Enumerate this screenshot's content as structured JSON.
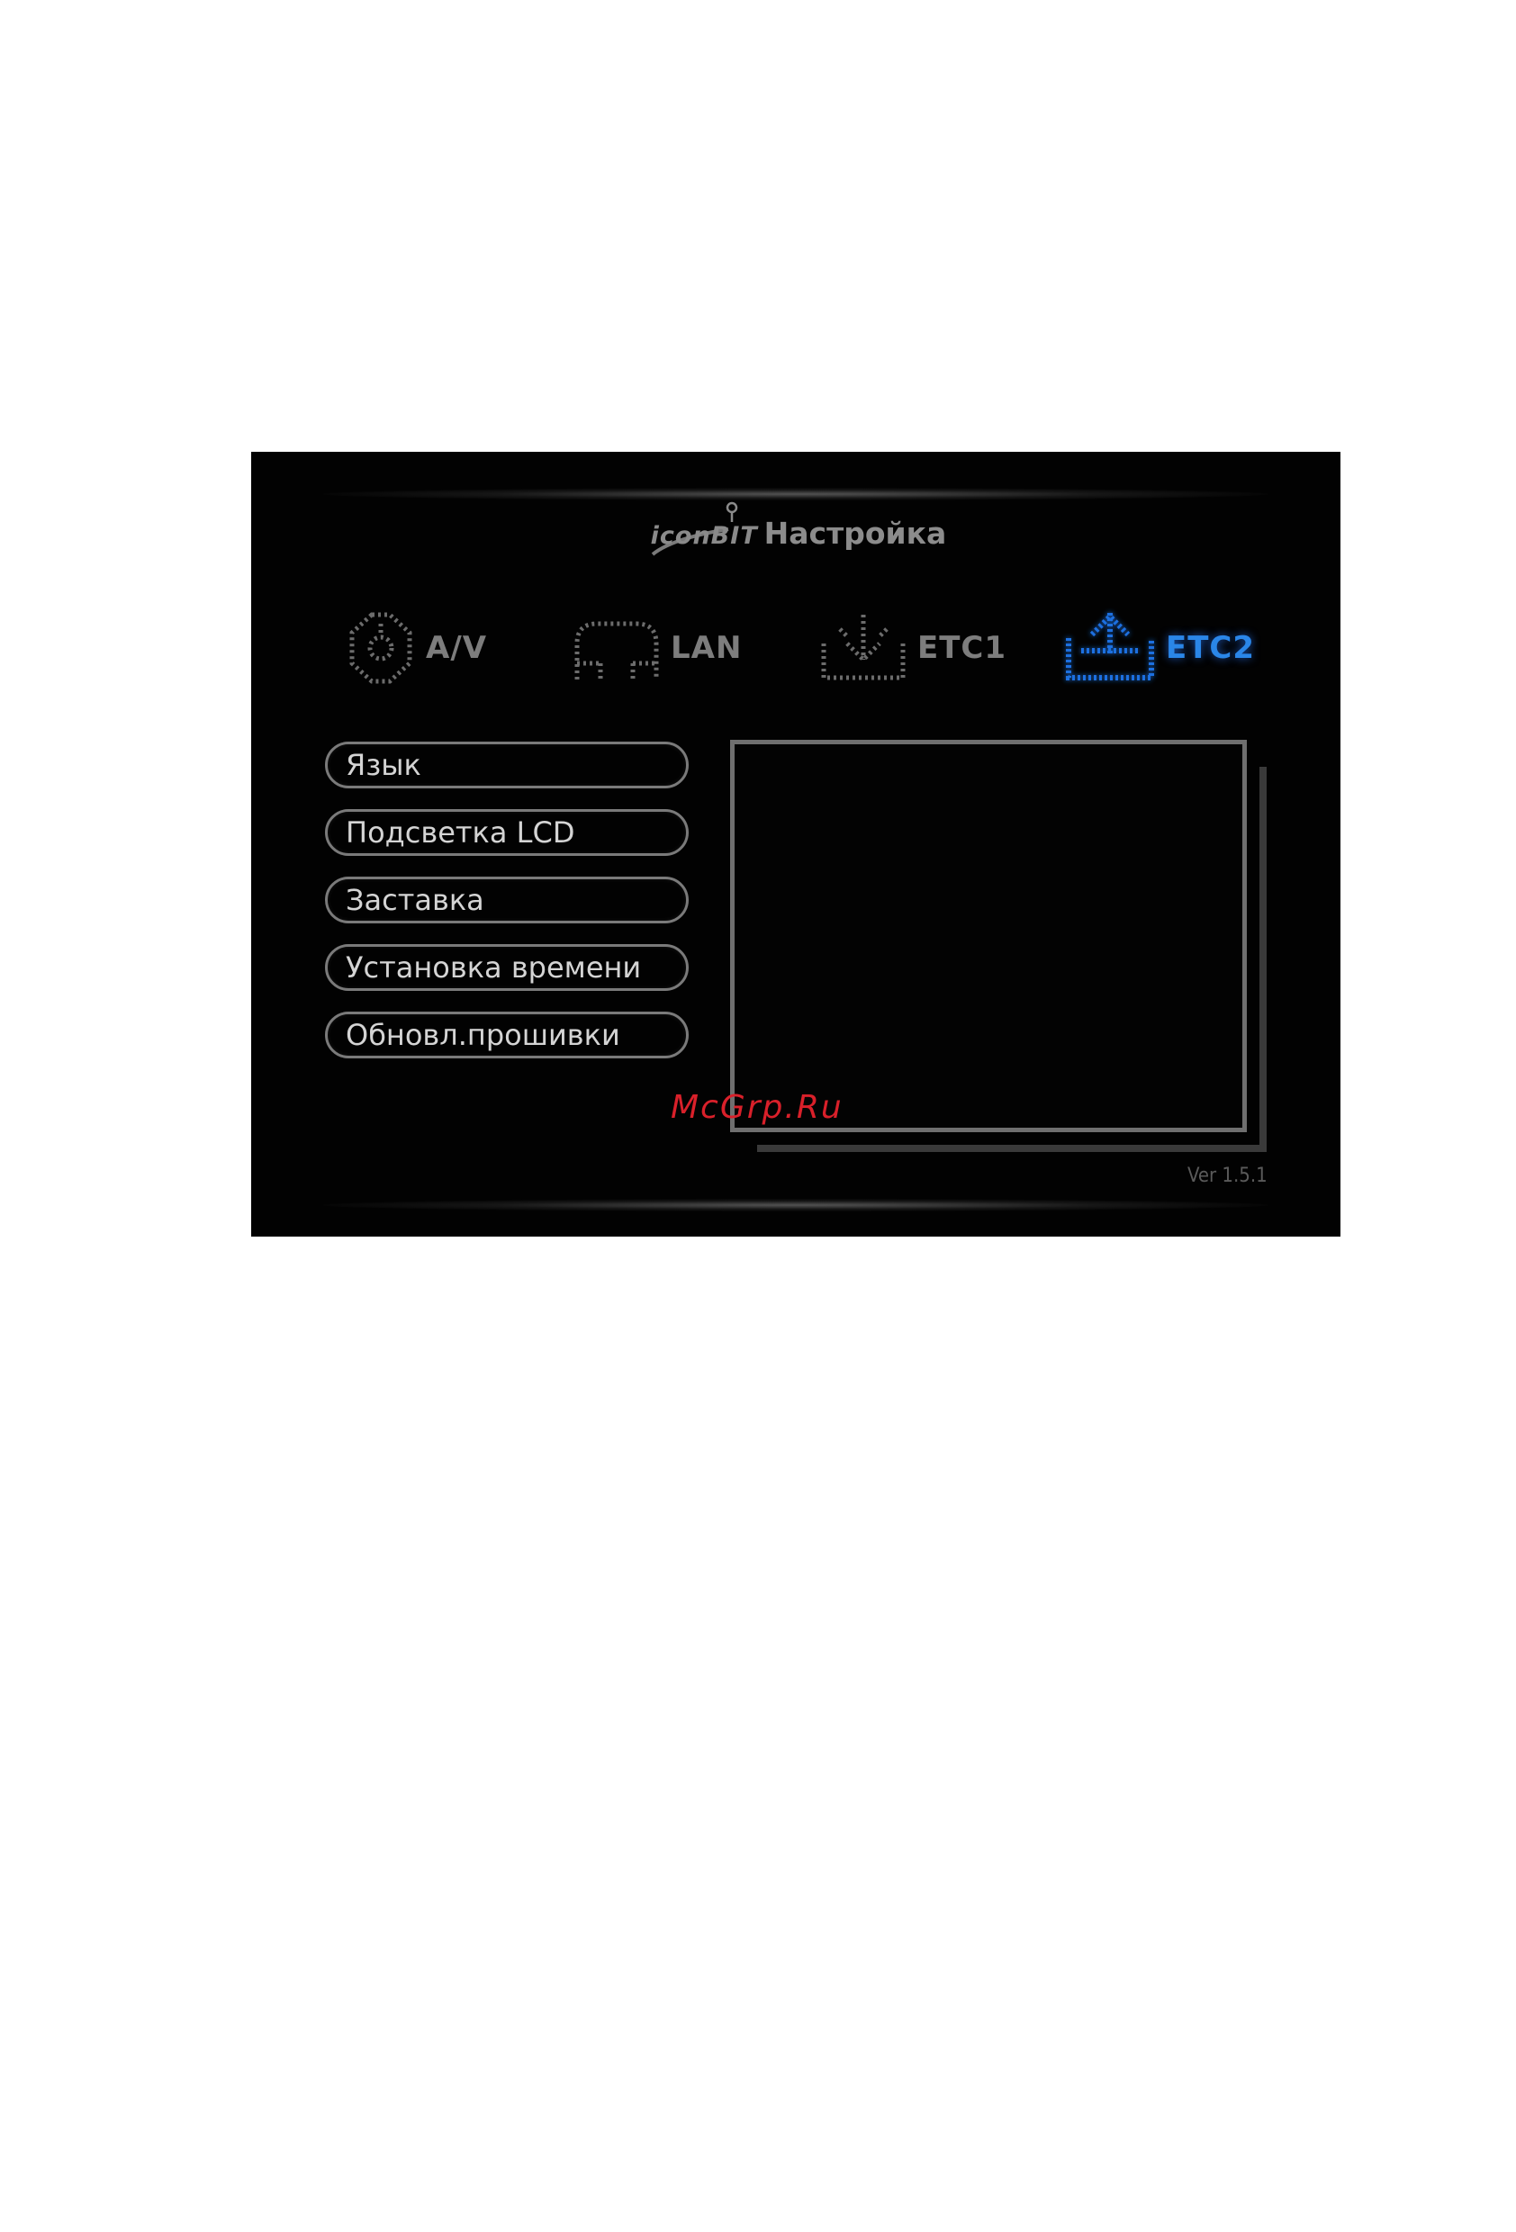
{
  "header": {
    "logo_text": "iconBIT",
    "title": "Настройка"
  },
  "tabs": [
    {
      "label": "A/V",
      "icon": "av-icon",
      "active": false
    },
    {
      "label": "LAN",
      "icon": "lan-icon",
      "active": false
    },
    {
      "label": "ETC1",
      "icon": "etc1-icon",
      "active": false
    },
    {
      "label": "ETC2",
      "icon": "etc2-icon",
      "active": true
    }
  ],
  "menu": {
    "items": [
      {
        "label": "Язык"
      },
      {
        "label": "Подсветка LCD"
      },
      {
        "label": "Заставка"
      },
      {
        "label": "Установка времени"
      },
      {
        "label": "Обновл.прошивки"
      }
    ]
  },
  "version": "Ver 1.5.1",
  "watermark": "McGrp.Ru",
  "colors": {
    "active_tab": "#2a86e8",
    "inactive_tab": "#7d7d7d",
    "screen_background": "#020202",
    "watermark": "#d9202a"
  }
}
